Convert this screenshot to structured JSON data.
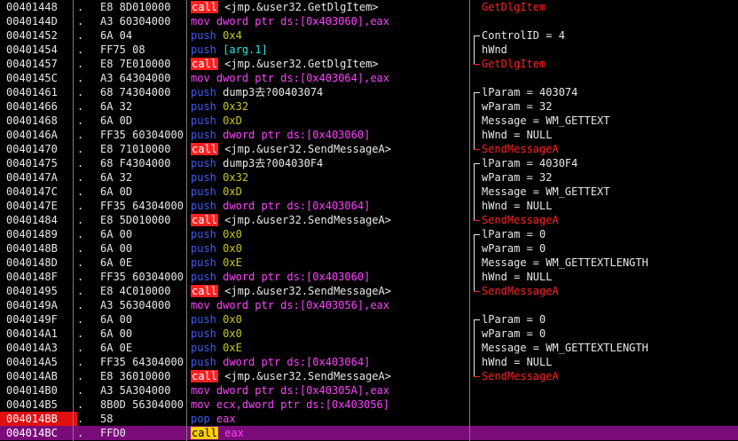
{
  "rows": [
    {
      "addr": "00401448",
      "dot": ".",
      "bytes": "E8 8D010000",
      "mn": "call",
      "op": "<jmp.&user32.GetDlgItem>",
      "opType": "call",
      "cmt": "GetDlgItem",
      "cmtRed": true
    },
    {
      "addr": "0040144D",
      "dot": ".",
      "bytes": "A3 60304000",
      "mn": "mov",
      "op": "dword ptr ds:[0x403060],eax",
      "opType": "mov",
      "cmt": "",
      "cmtRed": false
    },
    {
      "addr": "00401452",
      "dot": ".",
      "bytes": "6A 04",
      "mn": "push",
      "op": "0x4",
      "opType": "num",
      "cmt": "ControlID = 4",
      "cmtRed": false
    },
    {
      "addr": "00401454",
      "dot": ".",
      "bytes": "FF75 08",
      "mn": "push",
      "op": "[arg.1]",
      "opType": "arg",
      "cmt": "hWnd",
      "cmtRed": false
    },
    {
      "addr": "00401457",
      "dot": ".",
      "bytes": "E8 7E010000",
      "mn": "call",
      "op": "<jmp.&user32.GetDlgItem>",
      "opType": "call",
      "cmt": "GetDlgItem",
      "cmtRed": true
    },
    {
      "addr": "0040145C",
      "dot": ".",
      "bytes": "A3 64304000",
      "mn": "mov",
      "op": "dword ptr ds:[0x403064],eax",
      "opType": "mov",
      "cmt": "",
      "cmtRed": false
    },
    {
      "addr": "00401461",
      "dot": ".",
      "bytes": "68 74304000",
      "mn": "push",
      "op": "dump3去?00403074",
      "opType": "plain",
      "cmt": "lParam = 403074",
      "cmtRed": false
    },
    {
      "addr": "00401466",
      "dot": ".",
      "bytes": "6A 32",
      "mn": "push",
      "op": "0x32",
      "opType": "num",
      "cmt": "wParam = 32",
      "cmtRed": false
    },
    {
      "addr": "00401468",
      "dot": ".",
      "bytes": "6A 0D",
      "mn": "push",
      "op": "0xD",
      "opType": "num",
      "cmt": "Message = WM_GETTEXT",
      "cmtRed": false
    },
    {
      "addr": "0040146A",
      "dot": ".",
      "bytes": "FF35 60304000",
      "mn": "push",
      "op": "dword ptr ds:[0x403060]",
      "opType": "mem",
      "cmt": "hWnd = NULL",
      "cmtRed": false
    },
    {
      "addr": "00401470",
      "dot": ".",
      "bytes": "E8 71010000",
      "mn": "call",
      "op": "<jmp.&user32.SendMessageA>",
      "opType": "call",
      "cmt": "SendMessageA",
      "cmtRed": true
    },
    {
      "addr": "00401475",
      "dot": ".",
      "bytes": "68 F4304000",
      "mn": "push",
      "op": "dump3去?004030F4",
      "opType": "plain",
      "cmt": "lParam = 4030F4",
      "cmtRed": false
    },
    {
      "addr": "0040147A",
      "dot": ".",
      "bytes": "6A 32",
      "mn": "push",
      "op": "0x32",
      "opType": "num",
      "cmt": "wParam = 32",
      "cmtRed": false
    },
    {
      "addr": "0040147C",
      "dot": ".",
      "bytes": "6A 0D",
      "mn": "push",
      "op": "0xD",
      "opType": "num",
      "cmt": "Message = WM_GETTEXT",
      "cmtRed": false
    },
    {
      "addr": "0040147E",
      "dot": ".",
      "bytes": "FF35 64304000",
      "mn": "push",
      "op": "dword ptr ds:[0x403064]",
      "opType": "mem",
      "cmt": "hWnd = NULL",
      "cmtRed": false
    },
    {
      "addr": "00401484",
      "dot": ".",
      "bytes": "E8 5D010000",
      "mn": "call",
      "op": "<jmp.&user32.SendMessageA>",
      "opType": "call",
      "cmt": "SendMessageA",
      "cmtRed": true
    },
    {
      "addr": "00401489",
      "dot": ".",
      "bytes": "6A 00",
      "mn": "push",
      "op": "0x0",
      "opType": "num",
      "cmt": "lParam = 0",
      "cmtRed": false
    },
    {
      "addr": "0040148B",
      "dot": ".",
      "bytes": "6A 00",
      "mn": "push",
      "op": "0x0",
      "opType": "num",
      "cmt": "wParam = 0",
      "cmtRed": false
    },
    {
      "addr": "0040148D",
      "dot": ".",
      "bytes": "6A 0E",
      "mn": "push",
      "op": "0xE",
      "opType": "num",
      "cmt": "Message = WM_GETTEXTLENGTH",
      "cmtRed": false
    },
    {
      "addr": "0040148F",
      "dot": ".",
      "bytes": "FF35 60304000",
      "mn": "push",
      "op": "dword ptr ds:[0x403060]",
      "opType": "mem",
      "cmt": "hWnd = NULL",
      "cmtRed": false
    },
    {
      "addr": "00401495",
      "dot": ".",
      "bytes": "E8 4C010000",
      "mn": "call",
      "op": "<jmp.&user32.SendMessageA>",
      "opType": "call",
      "cmt": "SendMessageA",
      "cmtRed": true
    },
    {
      "addr": "0040149A",
      "dot": ".",
      "bytes": "A3 56304000",
      "mn": "mov",
      "op": "dword ptr ds:[0x403056],eax",
      "opType": "mov",
      "cmt": "",
      "cmtRed": false
    },
    {
      "addr": "0040149F",
      "dot": ".",
      "bytes": "6A 00",
      "mn": "push",
      "op": "0x0",
      "opType": "num",
      "cmt": "lParam = 0",
      "cmtRed": false
    },
    {
      "addr": "004014A1",
      "dot": ".",
      "bytes": "6A 00",
      "mn": "push",
      "op": "0x0",
      "opType": "num",
      "cmt": "wParam = 0",
      "cmtRed": false
    },
    {
      "addr": "004014A3",
      "dot": ".",
      "bytes": "6A 0E",
      "mn": "push",
      "op": "0xE",
      "opType": "num",
      "cmt": "Message = WM_GETTEXTLENGTH",
      "cmtRed": false
    },
    {
      "addr": "004014A5",
      "dot": ".",
      "bytes": "FF35 64304000",
      "mn": "push",
      "op": "dword ptr ds:[0x403064]",
      "opType": "mem",
      "cmt": "hWnd = NULL",
      "cmtRed": false
    },
    {
      "addr": "004014AB",
      "dot": ".",
      "bytes": "E8 36010000",
      "mn": "call",
      "op": "<jmp.&user32.SendMessageA>",
      "opType": "call",
      "cmt": "SendMessageA",
      "cmtRed": true
    },
    {
      "addr": "004014B0",
      "dot": ".",
      "bytes": "A3 5A304000",
      "mn": "mov",
      "op": "dword ptr ds:[0x40305A],eax",
      "opType": "mov",
      "cmt": "",
      "cmtRed": false
    },
    {
      "addr": "004014B5",
      "dot": ".",
      "bytes": "8B0D 56304000",
      "mn": "mov",
      "op": "ecx,dword ptr ds:[0x403056]",
      "opType": "mov",
      "cmt": "",
      "cmtRed": false
    },
    {
      "addr": "004014BB",
      "dot": ".",
      "bytes": "58",
      "mn": "pop",
      "op": "eax",
      "opType": "popreg",
      "cmt": "",
      "cmtRed": false,
      "breakpoint": true
    },
    {
      "addr": "004014BC",
      "dot": ".",
      "bytes": "FFD0",
      "mn": "call",
      "op": "eax",
      "opType": "popreg",
      "cmt": "",
      "cmtRed": false,
      "current": true
    }
  ],
  "colors": {
    "background": "#000000",
    "current_row": "#7a0c7a",
    "breakpoint": "#e01010",
    "call_mnemonic_bg": "#ff2020",
    "mov": "#ff40ff",
    "push": "#3a5cff",
    "number": "#c8c820",
    "arg": "#20e8e8"
  }
}
